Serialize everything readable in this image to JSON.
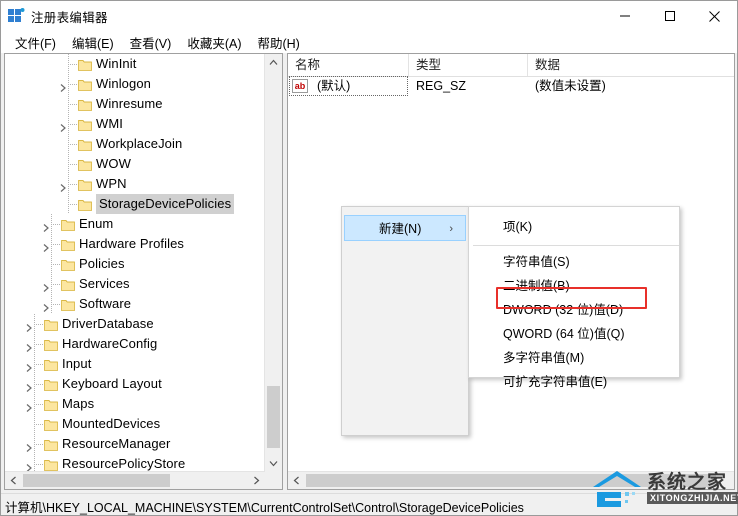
{
  "window": {
    "title": "注册表编辑器",
    "icon": "registry-icon",
    "buttons": {
      "minimize": "—",
      "maximize": "□",
      "close": "✕"
    }
  },
  "menubar": {
    "items": [
      {
        "label": "文件(F)",
        "name": "menu-file"
      },
      {
        "label": "编辑(E)",
        "name": "menu-edit"
      },
      {
        "label": "查看(V)",
        "name": "menu-view"
      },
      {
        "label": "收藏夹(A)",
        "name": "menu-favorites"
      },
      {
        "label": "帮助(H)",
        "name": "menu-help"
      }
    ]
  },
  "tree": {
    "nodes": [
      {
        "label": "WinInit",
        "indent": 3,
        "expander": "none",
        "selected": false
      },
      {
        "label": "Winlogon",
        "indent": 3,
        "expander": "collapsed",
        "selected": false
      },
      {
        "label": "Winresume",
        "indent": 3,
        "expander": "none",
        "selected": false
      },
      {
        "label": "WMI",
        "indent": 3,
        "expander": "collapsed",
        "selected": false
      },
      {
        "label": "WorkplaceJoin",
        "indent": 3,
        "expander": "none",
        "selected": false
      },
      {
        "label": "WOW",
        "indent": 3,
        "expander": "none",
        "selected": false
      },
      {
        "label": "WPN",
        "indent": 3,
        "expander": "collapsed",
        "selected": false
      },
      {
        "label": "StorageDevicePolicies",
        "indent": 3,
        "expander": "none",
        "selected": true
      },
      {
        "label": "Enum",
        "indent": 2,
        "expander": "collapsed",
        "selected": false
      },
      {
        "label": "Hardware Profiles",
        "indent": 2,
        "expander": "collapsed",
        "selected": false
      },
      {
        "label": "Policies",
        "indent": 2,
        "expander": "none",
        "selected": false
      },
      {
        "label": "Services",
        "indent": 2,
        "expander": "collapsed",
        "selected": false
      },
      {
        "label": "Software",
        "indent": 2,
        "expander": "collapsed",
        "selected": false
      },
      {
        "label": "DriverDatabase",
        "indent": 1,
        "expander": "collapsed",
        "selected": false
      },
      {
        "label": "HardwareConfig",
        "indent": 1,
        "expander": "collapsed",
        "selected": false
      },
      {
        "label": "Input",
        "indent": 1,
        "expander": "collapsed",
        "selected": false
      },
      {
        "label": "Keyboard Layout",
        "indent": 1,
        "expander": "collapsed",
        "selected": false
      },
      {
        "label": "Maps",
        "indent": 1,
        "expander": "collapsed",
        "selected": false
      },
      {
        "label": "MountedDevices",
        "indent": 1,
        "expander": "none",
        "selected": false
      },
      {
        "label": "ResourceManager",
        "indent": 1,
        "expander": "collapsed",
        "selected": false
      },
      {
        "label": "ResourcePolicyStore",
        "indent": 1,
        "expander": "collapsed",
        "selected": false
      }
    ]
  },
  "list": {
    "columns": [
      {
        "label": "名称",
        "name": "column-name"
      },
      {
        "label": "类型",
        "name": "column-type"
      },
      {
        "label": "数据",
        "name": "column-data"
      }
    ],
    "rows": [
      {
        "icon": "string-value-icon",
        "name": "(默认)",
        "type": "REG_SZ",
        "data": "(数值未设置)"
      }
    ]
  },
  "context_menu": {
    "primary": [
      {
        "label": "新建(N)",
        "submenu_arrow": "›",
        "highlighted": true,
        "name": "context-new"
      }
    ],
    "submenu": [
      {
        "label": "项(K)",
        "name": "submenu-key",
        "highlighted_box": false
      },
      {
        "label": "字符串值(S)",
        "name": "submenu-string-value",
        "highlighted_box": false
      },
      {
        "label": "二进制值(B)",
        "name": "submenu-binary-value",
        "highlighted_box": false
      },
      {
        "label": "DWORD (32 位)值(D)",
        "name": "submenu-dword-32",
        "highlighted_box": true
      },
      {
        "label": "QWORD (64 位)值(Q)",
        "name": "submenu-qword-64",
        "highlighted_box": false
      },
      {
        "label": "多字符串值(M)",
        "name": "submenu-multi-string",
        "highlighted_box": false
      },
      {
        "label": "可扩充字符串值(E)",
        "name": "submenu-expandable",
        "highlighted_box": false
      }
    ]
  },
  "status": {
    "path": "计算机\\HKEY_LOCAL_MACHINE\\SYSTEM\\CurrentControlSet\\Control\\StorageDevicePolicies"
  },
  "watermark": {
    "cn": "系统之家",
    "en": "XITONGZHIJIA.NET"
  },
  "colors": {
    "accent_highlight": "#cce8ff",
    "annotation_red": "#e8302a",
    "selection_gray": "#d0d0d0",
    "folder_yellow": "#ffd966",
    "scrollbar_thumb": "#cdcdcd"
  }
}
